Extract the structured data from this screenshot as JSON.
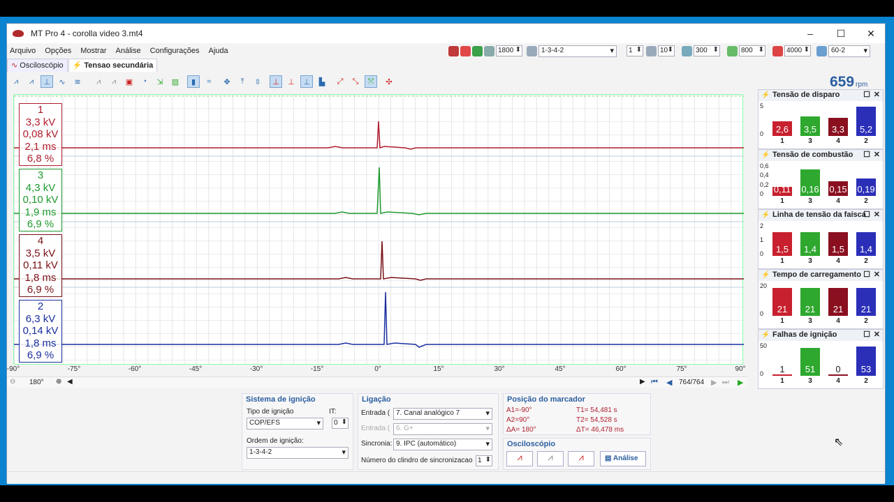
{
  "app": {
    "title": "MT Pro 4 - corolla video 3.mt4"
  },
  "menu": [
    "Arquivo",
    "Opções",
    "Mostrar",
    "Análise",
    "Configurações",
    "Ajuda"
  ],
  "topbar": {
    "rpm_limit": "1800",
    "firing_order": "1-3-4-2",
    "cyl": "1",
    "v1": "10",
    "v2": "300",
    "v3": "800",
    "v4": "4000",
    "wheel": "60-2"
  },
  "tabs": [
    "Osciloscópio",
    "Tensao secundária"
  ],
  "rpm": {
    "value": "659",
    "unit": "rpm"
  },
  "channels": [
    {
      "cyl": "1",
      "kv": "3,3 kV",
      "kv2": "0,08 kV",
      "ms": "2,1 ms",
      "pct": "6,8 %",
      "color": "#b01e2e"
    },
    {
      "cyl": "3",
      "kv": "4,3 kV",
      "kv2": "0,10 kV",
      "ms": "1,9 ms",
      "pct": "6,9 %",
      "color": "#1e9a2e"
    },
    {
      "cyl": "4",
      "kv": "3,5 kV",
      "kv2": "0,11 kV",
      "ms": "1,8 ms",
      "pct": "6,9 %",
      "color": "#7a1018"
    },
    {
      "cyl": "2",
      "kv": "6,3 kV",
      "kv2": "0,14 kV",
      "ms": "1,8 ms",
      "pct": "6,9 %",
      "color": "#1a2fa0"
    }
  ],
  "axis": {
    "ticks": [
      "-90°",
      "-75°",
      "-60°",
      "-45°",
      "-30°",
      "-15°",
      "0°",
      "15°",
      "30°",
      "45°",
      "60°",
      "75°",
      "90°"
    ],
    "span": "180°",
    "position": "764/764"
  },
  "panels": [
    {
      "title": "Tensão de disparo",
      "yticks": [
        "5",
        "0"
      ],
      "values": [
        "2,6",
        "3,5",
        "3,3",
        "5,2"
      ],
      "levels": [
        0.5,
        0.67,
        0.63,
        1.0
      ]
    },
    {
      "title": "Tensão de combustão",
      "yticks": [
        "0,6",
        "0,4",
        "0,2",
        "0"
      ],
      "values": [
        "0,11",
        "0,16",
        "0,15",
        "0,19"
      ],
      "levels": [
        0.3,
        0.9,
        0.5,
        0.6
      ]
    },
    {
      "title": "Linha de tensão da faísca",
      "yticks": [
        "2",
        "1",
        "0"
      ],
      "values": [
        "1,5",
        "1,4",
        "1,5",
        "1,4"
      ],
      "levels": [
        0.8,
        0.8,
        0.8,
        0.8
      ]
    },
    {
      "title": "Tempo de carregamento",
      "yticks": [
        "20",
        "0"
      ],
      "values": [
        "21",
        "21",
        "21",
        "21"
      ],
      "levels": [
        0.95,
        0.95,
        0.95,
        0.95
      ]
    },
    {
      "title": "Falhas de ignição",
      "yticks": [
        "50",
        "0"
      ],
      "values": [
        "1",
        "51",
        "0",
        "53"
      ],
      "levels": [
        0.02,
        0.96,
        0.0,
        1.0
      ]
    }
  ],
  "bar_labels": [
    "1",
    "3",
    "4",
    "2"
  ],
  "bar_colors": [
    "#c8202e",
    "#2ea82e",
    "#8a1020",
    "#2b2fb8"
  ],
  "ignicao": {
    "title": "Sistema de ignição",
    "tipo_label": "Tipo de ignição",
    "tipo": "COP/EFS",
    "it_label": "IT:",
    "it": "0",
    "ordem_label": "Ordem de ignição:",
    "ordem": "1-3-4-2"
  },
  "ligacao": {
    "title": "Ligação",
    "entrada_label": "Entrada (",
    "entrada": "7. Canal analógico 7",
    "entrada2_label": "Entrada (",
    "entrada2": "6. G+",
    "sinc_label": "Sincronia:",
    "sinc": "9. IPC (automático)",
    "ncil_label": "Número do clindro de sincronizacao",
    "ncil": "1"
  },
  "marcador": {
    "title": "Posição do marcador",
    "a1": "A1=-90°",
    "a2": "A2=90°",
    "da": "ΔA= 180°",
    "t1": "T1= 54,481 s",
    "t2": "T2= 54,528 s",
    "dt": "ΔT= 46,478 ms"
  },
  "osc": {
    "title": "Osciloscópio",
    "analise": "Análise"
  }
}
